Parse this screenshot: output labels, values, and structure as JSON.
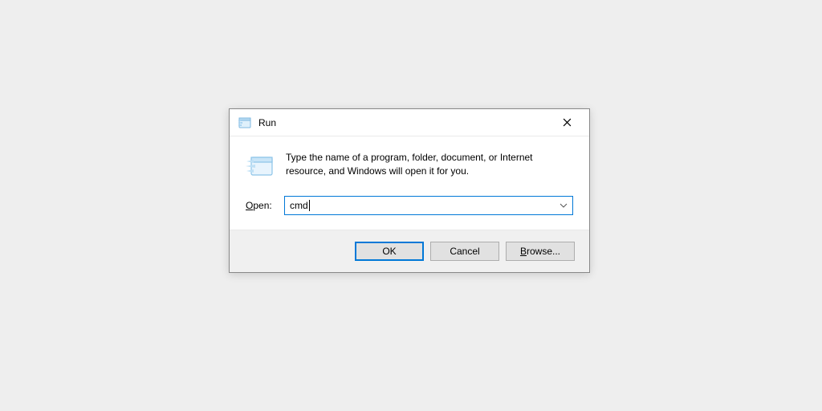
{
  "dialog": {
    "title": "Run",
    "description": "Type the name of a program, folder, document, or Internet resource, and Windows will open it for you.",
    "open_label_letter": "O",
    "open_label_rest": "pen:",
    "input_value": "cmd",
    "buttons": {
      "ok": "OK",
      "cancel": "Cancel",
      "browse_letter": "B",
      "browse_rest": "rowse..."
    }
  }
}
